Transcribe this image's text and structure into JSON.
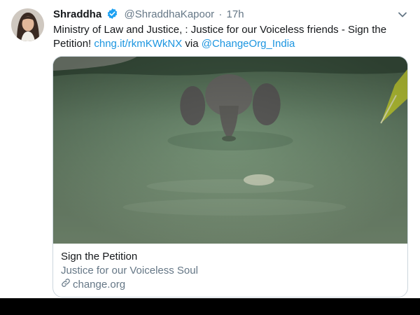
{
  "tweet": {
    "display_name": "Shraddha",
    "handle": "@ShraddhaKapoor",
    "separator": "·",
    "time": "17h",
    "text_part1": "Ministry of Law and Justice, : Justice for our Voiceless friends - Sign the Petition! ",
    "link1": "chng.it/rkmKWkNX",
    "text_part2": " via ",
    "mention": "@ChangeOrg_India"
  },
  "card": {
    "title": "Sign the Petition",
    "description": "Justice for our Voiceless Soul",
    "domain": "change.org"
  },
  "icons": {
    "verified": "verified-badge-icon",
    "menu": "chevron-down-icon",
    "domain": "link-icon"
  },
  "colors": {
    "link": "#1b95e0",
    "verified": "#1da1f2",
    "muted": "#657786",
    "border": "#ccd6dd"
  }
}
